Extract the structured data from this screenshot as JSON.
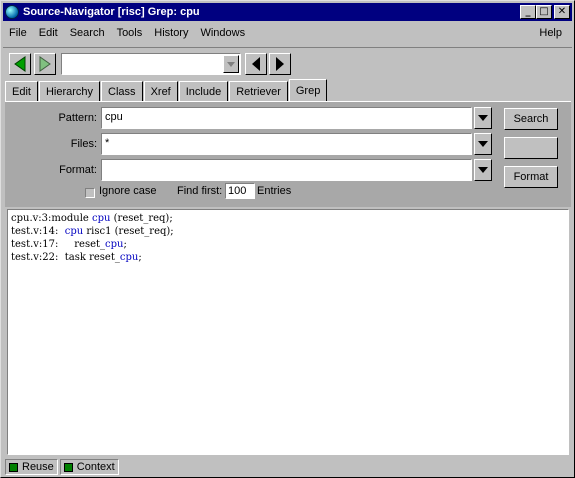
{
  "window": {
    "title": "Source-Navigator [risc] Grep: cpu",
    "minimize_glyph": "_",
    "maximize_glyph": "□",
    "close_glyph": "✕"
  },
  "menu": {
    "file": "File",
    "edit": "Edit",
    "search": "Search",
    "tools": "Tools",
    "history": "History",
    "windows": "Windows",
    "help": "Help"
  },
  "toolbar": {
    "combo_value": "",
    "back_icon": "arrow-left-icon",
    "forward_icon": "arrow-right-icon"
  },
  "tabs": [
    "Edit",
    "Hierarchy",
    "Class",
    "Xref",
    "Include",
    "Retriever",
    "Grep"
  ],
  "active_tab": "Grep",
  "grep": {
    "pattern_label": "Pattern:",
    "pattern_value": "cpu",
    "files_label": "Files:",
    "files_value": "*",
    "format_label": "Format:",
    "format_value": "",
    "ignore_case_label": "Ignore case",
    "ignore_case_checked": false,
    "find_first_label": "Find first:",
    "find_first_value": "100",
    "entries_label": "Entries",
    "search_button": "Search",
    "blank_button": "",
    "format_button": "Format"
  },
  "results": [
    {
      "prefix": "cpu.v:3:module ",
      "match": "cpu",
      "suffix": " (reset_req);"
    },
    {
      "prefix": "test.v:14:  ",
      "match": "cpu",
      "suffix": " risc1 (reset_req);"
    },
    {
      "prefix": "test.v:17:     reset_",
      "match": "cpu",
      "suffix": ";"
    },
    {
      "prefix": "test.v:22:  task reset_",
      "match": "cpu",
      "suffix": ";"
    }
  ],
  "status": {
    "reuse": "Reuse",
    "context": "Context",
    "indicator_color": "#008000"
  },
  "colors": {
    "title_bar": "#000080",
    "match_highlight": "#0000c0"
  }
}
